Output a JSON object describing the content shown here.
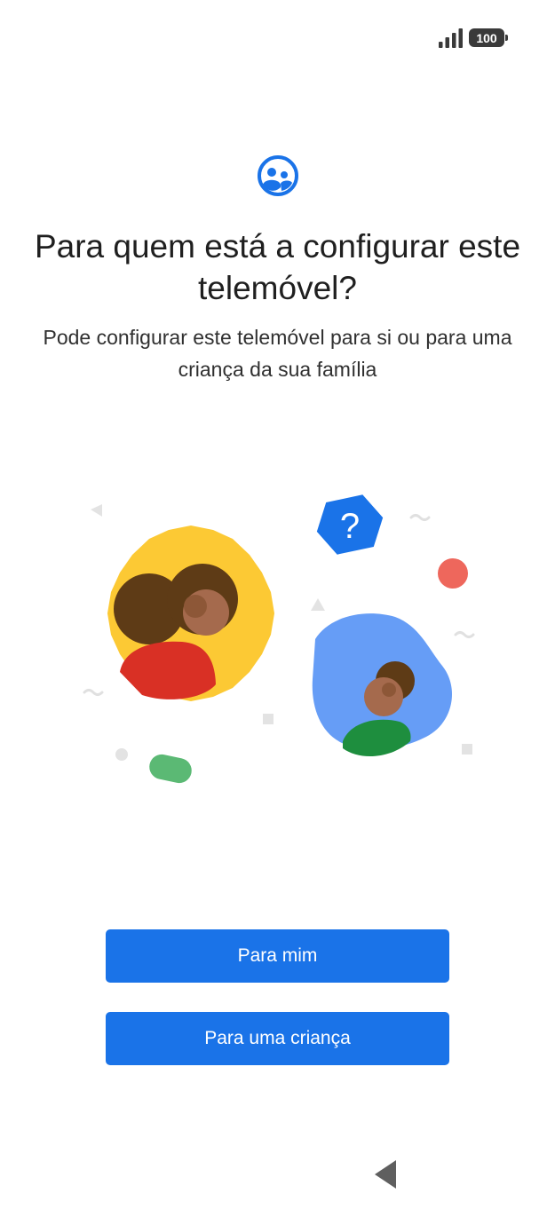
{
  "status_bar": {
    "battery_level": "100",
    "icons": [
      "signal-icon",
      "battery-icon"
    ]
  },
  "header": {
    "icon": "supervised-user-icon",
    "icon_color": "#1a73e8",
    "title": "Para quem está a configurar este telemóvel?",
    "subtitle": "Pode configurar este telemóvel para si ou para uma criança da sua família"
  },
  "actions": {
    "for_me_label": "Para mim",
    "for_child_label": "Para uma criança",
    "button_color": "#1a73e8"
  },
  "navigation": {
    "icons": [
      "back-icon"
    ]
  }
}
